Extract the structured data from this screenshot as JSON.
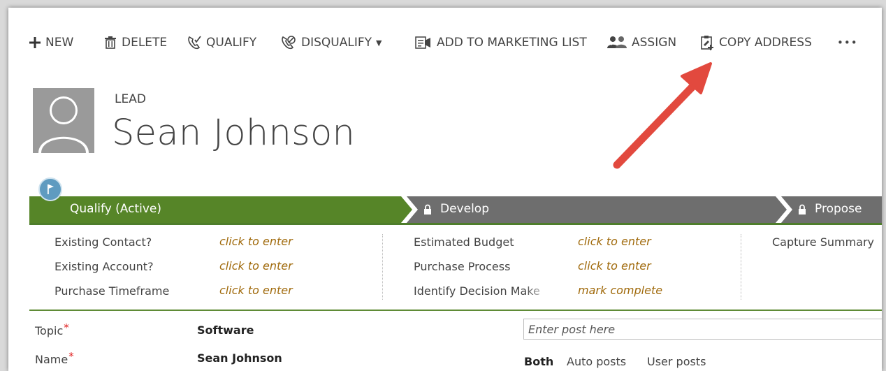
{
  "toolbar": {
    "new_label": "NEW",
    "delete_label": "DELETE",
    "qualify_label": "QUALIFY",
    "disqualify_label": "DISQUALIFY",
    "marketing_label": "ADD TO MARKETING LIST",
    "assign_label": "ASSIGN",
    "copy_address_label": "COPY ADDRESS",
    "more_label": "•••"
  },
  "header": {
    "entity": "LEAD",
    "name": "Sean Johnson"
  },
  "process": {
    "stages": [
      {
        "label": "Qualify (Active)",
        "state": "active",
        "color": "#568528"
      },
      {
        "label": "Develop",
        "state": "locked",
        "color": "#6e6e6e"
      },
      {
        "label": "Propose",
        "state": "locked",
        "color": "#6e6e6e"
      }
    ],
    "qualify_fields": [
      {
        "label": "Existing Contact?",
        "value": "click to enter"
      },
      {
        "label": "Existing Account?",
        "value": "click to enter"
      },
      {
        "label": "Purchase Timeframe",
        "value": "click to enter"
      }
    ],
    "develop_fields": [
      {
        "label": "Estimated Budget",
        "value": "click to enter"
      },
      {
        "label": "Purchase Process",
        "value": "click to enter"
      },
      {
        "label": "Identify Decision Make",
        "value": "mark complete"
      }
    ],
    "propose_fields": [
      {
        "label": "Capture Summary"
      }
    ]
  },
  "form": {
    "topic_label": "Topic",
    "topic_value": "Software",
    "name_label": "Name",
    "name_value": "Sean Johnson",
    "required_mark": "*"
  },
  "posts": {
    "placeholder": "Enter post here",
    "filters": [
      "Both",
      "Auto posts",
      "User posts"
    ]
  },
  "colors": {
    "accent_green": "#568528",
    "stage_gray": "#6e6e6e",
    "value_gold": "#a06a0c",
    "annotation_arrow": "#e2493e"
  }
}
